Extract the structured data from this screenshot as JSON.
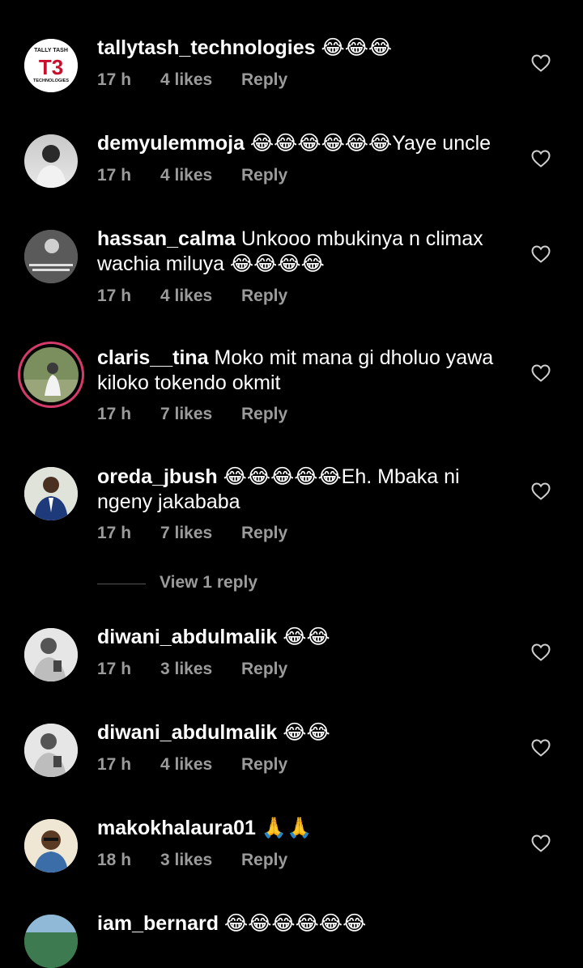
{
  "comments": [
    {
      "username": "tallytash_technologies",
      "text": " 😂😂😂",
      "time": "17 h",
      "likes": "4 likes",
      "reply": "Reply",
      "avatar_text_top": "TALLY TASH",
      "avatar_text_logo": "T3",
      "avatar_text_bottom": "TECHNOLOGIES"
    },
    {
      "username": "demyulemmoja",
      "text": " 😂😂😂😂😂😂Yaye uncle",
      "time": "17 h",
      "likes": "4 likes",
      "reply": "Reply"
    },
    {
      "username": "hassan_calma",
      "text": " Unkooo mbukinya n climax wachia miluya 😂😂😂😂",
      "time": "17 h",
      "likes": "4 likes",
      "reply": "Reply"
    },
    {
      "username": "claris__tina",
      "text": " Moko mit mana gi dholuo yawa kiloko tokendo okmit",
      "time": "17 h",
      "likes": "7 likes",
      "reply": "Reply"
    },
    {
      "username": "oreda_jbush",
      "text": " 😂😂😂😂😂Eh. Mbaka ni ngeny jakababa",
      "time": "17 h",
      "likes": "7 likes",
      "reply": "Reply"
    },
    {
      "username": "diwani_abdulmalik",
      "text": " 😂😂",
      "time": "17 h",
      "likes": "3 likes",
      "reply": "Reply"
    },
    {
      "username": "diwani_abdulmalik",
      "text": " 😂😂",
      "time": "17 h",
      "likes": "4 likes",
      "reply": "Reply"
    },
    {
      "username": "makokhalaura01",
      "text": " 🙏🙏",
      "time": "18 h",
      "likes": "3 likes",
      "reply": "Reply"
    },
    {
      "username": "iam_bernard",
      "text": " 😂😂😂😂😂😂"
    }
  ],
  "view_replies": "View 1 reply",
  "colors": {
    "background": "#000000",
    "meta": "#9b9b9b",
    "story_ring": "#d43a6a"
  }
}
